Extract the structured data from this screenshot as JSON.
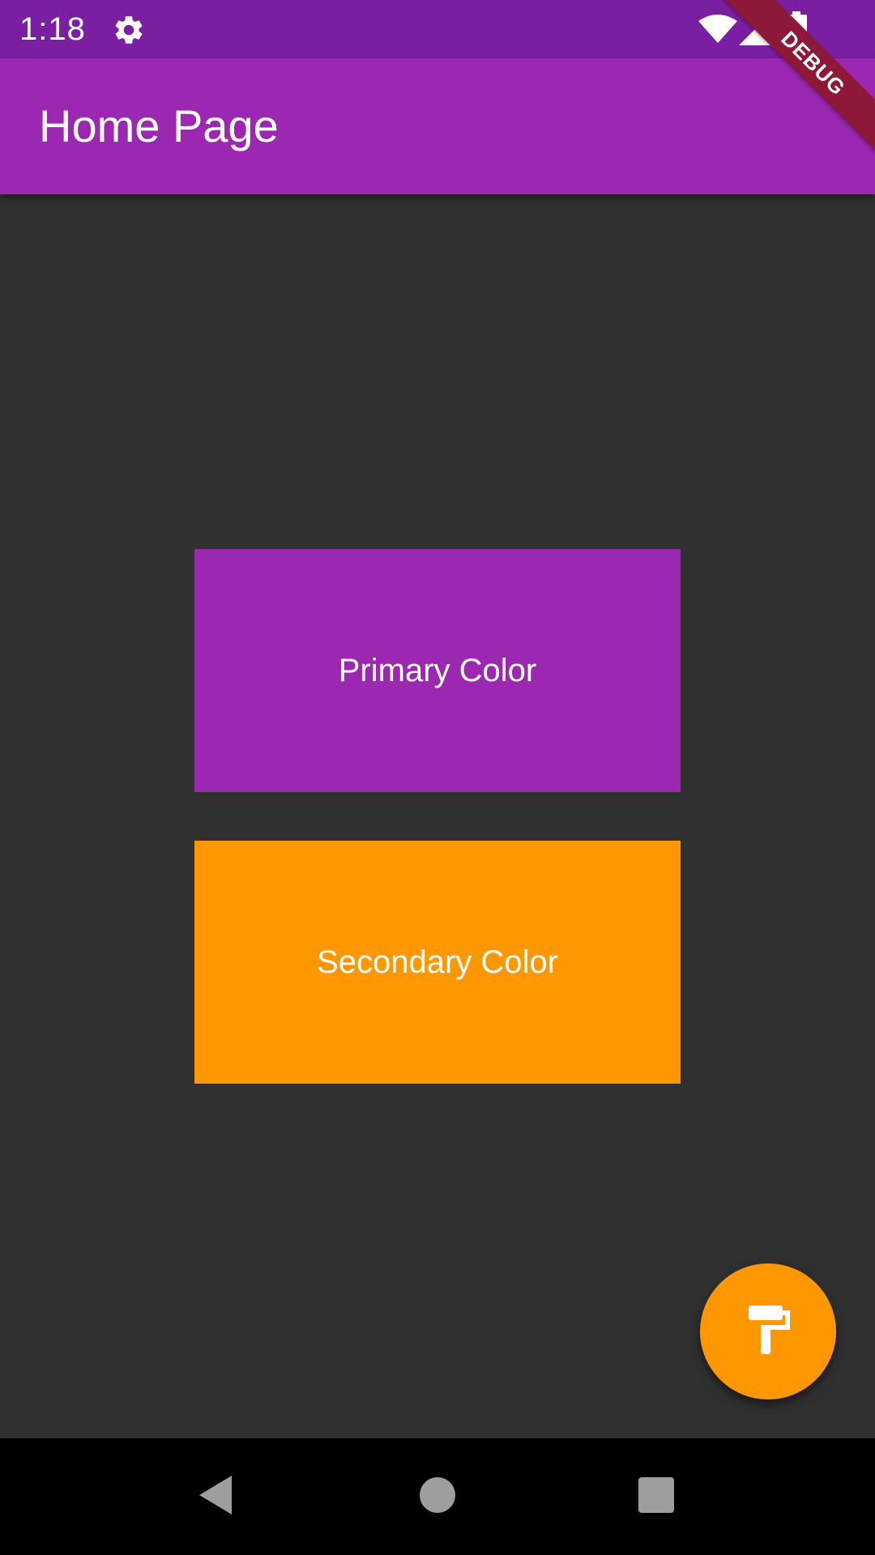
{
  "status_bar": {
    "time": "1:18",
    "icons": [
      "gear-icon",
      "wifi-icon",
      "cell-signal-icon",
      "battery-icon"
    ],
    "color": "#7B1FA2"
  },
  "app_bar": {
    "title": "Home Page",
    "color": "#9C27B0"
  },
  "debug_banner": {
    "label": "DEBUG"
  },
  "boxes": {
    "primary": {
      "label": "Primary Color",
      "color": "#9C27B0"
    },
    "secondary": {
      "label": "Secondary Color",
      "color": "#FF9800"
    }
  },
  "fab": {
    "icon": "paint-roller-icon",
    "color": "#FF9800"
  },
  "nav_bar": {
    "icons": [
      "back-icon",
      "home-icon",
      "recents-icon"
    ]
  },
  "theme": {
    "background": "#303030"
  }
}
